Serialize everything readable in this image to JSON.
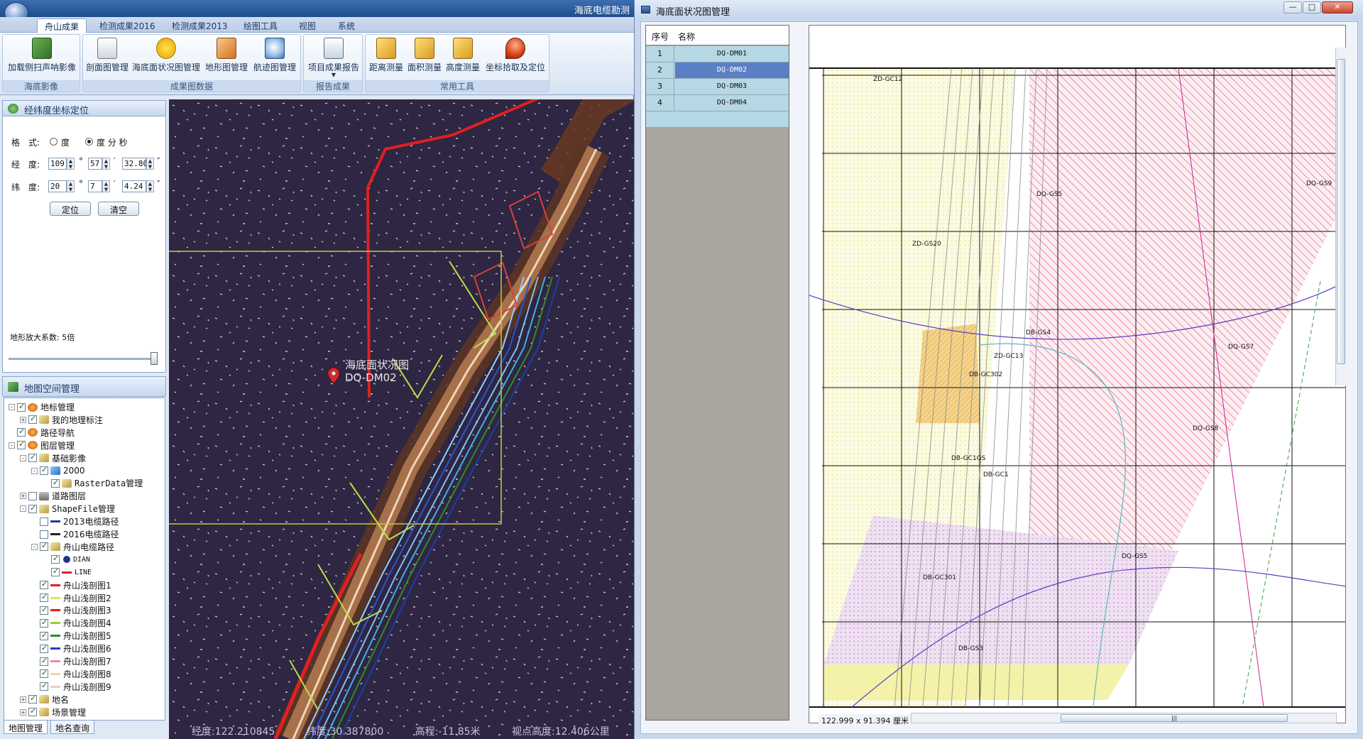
{
  "app": {
    "title": "海底电缆勘测",
    "tabs": [
      "舟山成果",
      "检测成果2016",
      "检测成果2013",
      "绘图工具",
      "视图",
      "系统"
    ],
    "active_tab": 0
  },
  "ribbon": {
    "groups": [
      {
        "label": "海底影像",
        "buttons": [
          {
            "label": "加载侧扫声呐影像",
            "icon": "map-icon"
          }
        ]
      },
      {
        "label": "成果图数据",
        "buttons": [
          {
            "label": "剖面图管理",
            "icon": "document-icon"
          },
          {
            "label": "海底面状况图管理",
            "icon": "warning-icon"
          },
          {
            "label": "地形图管理",
            "icon": "edit-icon"
          },
          {
            "label": "航迹图管理",
            "icon": "magnifier-icon"
          }
        ]
      },
      {
        "label": "报告成果",
        "buttons": [
          {
            "label": "项目成果报告",
            "icon": "report-icon"
          }
        ]
      },
      {
        "label": "常用工具",
        "buttons": [
          {
            "label": "距离测量",
            "icon": "ruler-icon"
          },
          {
            "label": "面积测量",
            "icon": "area-icon"
          },
          {
            "label": "高度测量",
            "icon": "height-icon"
          },
          {
            "label": "坐标拾取及定位",
            "icon": "pin-icon"
          }
        ]
      }
    ]
  },
  "coord_panel": {
    "title": "经纬度坐标定位",
    "format_label": "格　式:",
    "format_options": [
      "度",
      "度 分 秒"
    ],
    "format_selected": 1,
    "lon_label": "经　度:",
    "lon": {
      "deg": "109",
      "min": "57",
      "sec": "32.80"
    },
    "lat_label": "纬　度:",
    "lat": {
      "deg": "20",
      "min": "7",
      "sec": "4.24"
    },
    "deg_symbol": "°",
    "min_symbol": "′",
    "sec_symbol": "″",
    "locate_button": "定位",
    "clear_button": "清空",
    "zoom_label": "地形放大系数: 5倍",
    "zoom_value": 1.0
  },
  "tree_panel": {
    "title": "地图空间管理",
    "nodes": [
      {
        "label": "地标管理",
        "level": 0,
        "icon": "globe",
        "checked": true,
        "exp": "-"
      },
      {
        "label": "我的地理标注",
        "level": 1,
        "icon": "layer",
        "checked": true,
        "exp": "+"
      },
      {
        "label": "路径导航",
        "level": 0,
        "icon": "globe",
        "checked": true,
        "exp": ""
      },
      {
        "label": "图层管理",
        "level": 0,
        "icon": "globe",
        "checked": true,
        "exp": "-"
      },
      {
        "label": "基础影像",
        "level": 1,
        "icon": "layer",
        "checked": true,
        "exp": "-"
      },
      {
        "label": "2000",
        "level": 2,
        "icon": "raster",
        "checked": true,
        "exp": "-"
      },
      {
        "label": "RasterData管理",
        "level": 3,
        "icon": "layer",
        "checked": true,
        "exp": ""
      },
      {
        "label": "道路图层",
        "level": 1,
        "icon": "road",
        "checked": false,
        "exp": "+"
      },
      {
        "label": "ShapeFile管理",
        "level": 1,
        "icon": "layer",
        "checked": true,
        "exp": "-"
      },
      {
        "label": "2013电缆路径",
        "level": 2,
        "icon": "line",
        "color": "#2b3a8c",
        "checked": false,
        "exp": ""
      },
      {
        "label": "2016电缆路径",
        "level": 2,
        "icon": "line",
        "color": "#222222",
        "checked": false,
        "exp": ""
      },
      {
        "label": "舟山电缆路径",
        "level": 2,
        "icon": "layer",
        "checked": true,
        "exp": "-"
      },
      {
        "label": "DIAN",
        "level": 3,
        "icon": "dot",
        "checked": true,
        "exp": ""
      },
      {
        "label": "LINE",
        "level": 3,
        "icon": "line",
        "color": "#e02020",
        "checked": true,
        "exp": ""
      },
      {
        "label": "舟山浅剖图1",
        "level": 2,
        "icon": "line",
        "color": "#e02020",
        "checked": true,
        "exp": ""
      },
      {
        "label": "舟山浅剖图2",
        "level": 2,
        "icon": "line",
        "color": "#e8e060",
        "checked": true,
        "exp": ""
      },
      {
        "label": "舟山浅剖图3",
        "level": 2,
        "icon": "line",
        "color": "#e02020",
        "checked": true,
        "exp": ""
      },
      {
        "label": "舟山浅剖图4",
        "level": 2,
        "icon": "line",
        "color": "#9acd32",
        "checked": true,
        "exp": ""
      },
      {
        "label": "舟山浅剖图5",
        "level": 2,
        "icon": "line",
        "color": "#2e8b2e",
        "checked": true,
        "exp": ""
      },
      {
        "label": "舟山浅剖图6",
        "level": 2,
        "icon": "line",
        "color": "#2040c0",
        "checked": true,
        "exp": ""
      },
      {
        "label": "舟山浅剖图7",
        "level": 2,
        "icon": "line",
        "color": "#f08aa0",
        "checked": true,
        "exp": ""
      },
      {
        "label": "舟山浅剖图8",
        "level": 2,
        "icon": "line",
        "color": "#f2d6a0",
        "checked": true,
        "exp": ""
      },
      {
        "label": "舟山浅剖图9",
        "level": 2,
        "icon": "line",
        "color": "#f3c8c8",
        "checked": true,
        "exp": ""
      },
      {
        "label": "地名",
        "level": 1,
        "icon": "layer",
        "checked": true,
        "exp": "+"
      },
      {
        "label": "场景管理",
        "level": 1,
        "icon": "layer",
        "checked": true,
        "exp": "+"
      }
    ],
    "bottom_tabs": [
      "地图管理",
      "地名查询"
    ]
  },
  "map": {
    "label_line1": "海底面状况图",
    "label_line2": "DQ-DM02",
    "status": {
      "lon": "经度:122.210845",
      "lat": "纬度:30.387800",
      "elev": "高程:-11.85米",
      "view": "视点高度:12.406公里"
    }
  },
  "dialog": {
    "title": "海底面状况图管理",
    "grid_headers": [
      "序号",
      "名称"
    ],
    "rows": [
      {
        "no": "1",
        "name": "DQ-DM01"
      },
      {
        "no": "2",
        "name": "DQ-DM02"
      },
      {
        "no": "3",
        "name": "DQ-DM03"
      },
      {
        "no": "4",
        "name": "DQ-DM04"
      }
    ],
    "selected_row": 1,
    "dimension": "122.999 x 91.394 厘米",
    "drawing_labels": [
      "ZD-GC12",
      "DQ-GS5",
      "ZD-GS20",
      "DB-GS4",
      "DQ-GS7",
      "ZD-GC13",
      "DB-GC302",
      "DQ-GS8",
      "DB-GC1",
      "DB-GC1GS",
      "DB-GC301",
      "DQ-GS5",
      "DB-GS3",
      "DQ-GS9"
    ]
  }
}
